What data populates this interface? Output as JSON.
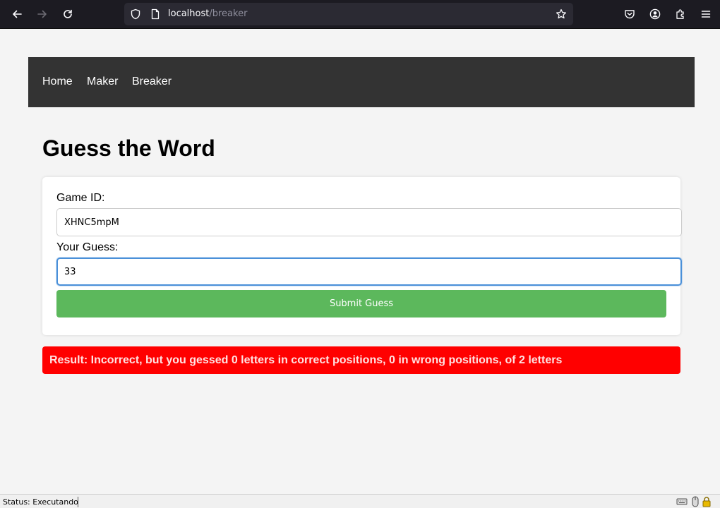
{
  "browser": {
    "url_host": "localhost",
    "url_path": "/breaker",
    "icons": [
      "back-arrow-icon",
      "forward-arrow-icon",
      "reload-icon",
      "shield-icon",
      "page-icon",
      "bookmark-star-icon",
      "pocket-icon",
      "account-icon",
      "extensions-icon",
      "menu-icon"
    ]
  },
  "nav": {
    "home": "Home",
    "maker": "Maker",
    "breaker": "Breaker"
  },
  "main": {
    "title": "Guess the Word",
    "game_id_label": "Game ID:",
    "game_id_value": "XHNC5mpM",
    "guess_label": "Your Guess:",
    "guess_value": "33",
    "submit_label": "Submit Guess",
    "result": "Result: Incorrect, but you gessed 0 letters in correct positions, 0 in wrong positions, of 2 letters"
  },
  "status_bar": {
    "text": "Status: Executando"
  },
  "colors": {
    "navbar": "#333333",
    "submit": "#5cb85c",
    "result": "#ff0000",
    "focus": "#4a90d9"
  }
}
